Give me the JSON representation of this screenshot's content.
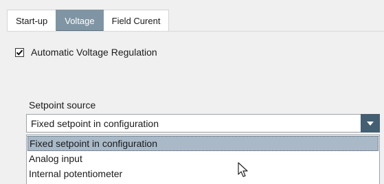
{
  "tabs": [
    {
      "label": "Start-up",
      "active": false
    },
    {
      "label": "Voltage",
      "active": true
    },
    {
      "label": "Field Curent",
      "active": false
    }
  ],
  "avr_checkbox": {
    "label": "Automatic Voltage Regulation",
    "checked": true
  },
  "setpoint": {
    "label": "Setpoint source",
    "selected_value": "Fixed setpoint in configuration",
    "options": [
      "Fixed setpoint in configuration",
      "Analog input",
      "Internal potentiometer"
    ],
    "highlighted_index": 0
  },
  "colors": {
    "active_tab": "#8095a4",
    "dropdown_button": "#445e72",
    "highlight": "#a9b9c8"
  },
  "icons": {
    "check": "check-icon",
    "dropdown": "chevron-down-icon",
    "cursor": "mouse-pointer-icon"
  }
}
